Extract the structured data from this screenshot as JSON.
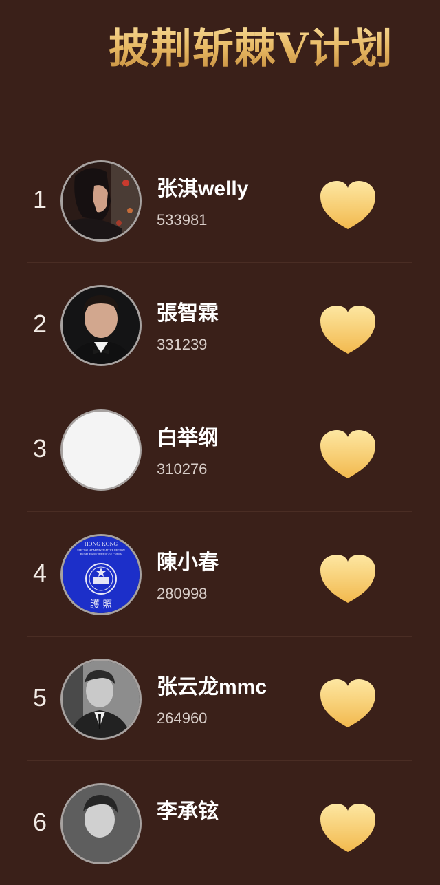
{
  "page": {
    "title": "披荆斩棘V计划"
  },
  "colors": {
    "background": "#3a2019",
    "gold_top": "#fde7a2",
    "gold_bottom": "#f2b94e"
  },
  "ranking": [
    {
      "rank": "1",
      "name": "张淇welly",
      "count": "533981",
      "avatar": "man-long-hair-photo"
    },
    {
      "rank": "2",
      "name": "張智霖",
      "count": "331239",
      "avatar": "man-bowtie-photo"
    },
    {
      "rank": "3",
      "name": "白举纲",
      "count": "310276",
      "avatar": "blank-avatar"
    },
    {
      "rank": "4",
      "name": "陳小春",
      "count": "280998",
      "avatar": "hong-kong-passport-emblem"
    },
    {
      "rank": "5",
      "name": "张云龙mmc",
      "count": "264960",
      "avatar": "man-suit-bw-photo"
    },
    {
      "rank": "6",
      "name": "李承铉",
      "count": "",
      "avatar": "man-bw-photo"
    }
  ],
  "avatar4_text": {
    "top": "HONG KONG",
    "sub1": "SPECIAL ADMINISTRATIVE REGION",
    "sub2": "PEOPLE'S REPUBLIC OF CHINA",
    "bottom": "護  照"
  }
}
